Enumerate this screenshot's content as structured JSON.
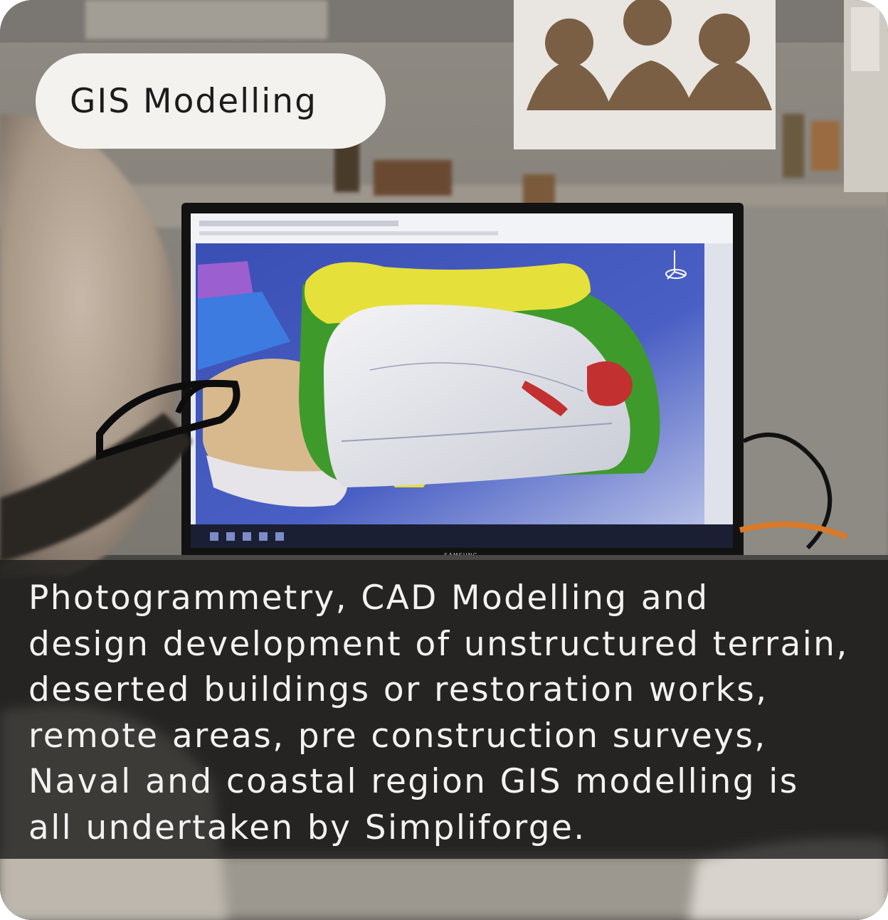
{
  "card": {
    "badge_label": "GIS Modelling",
    "caption_lines": [
      "Photogrammetry, CAD Modelling and",
      "design development of unstructured terrain,",
      "deserted buildings or restoration works,",
      "remote areas, pre construction surveys,",
      "Naval and coastal region GIS modelling is",
      "all undertaken by Simpliforge."
    ],
    "monitor_brand": "SAMSUNG"
  },
  "colors": {
    "badge_bg": "#f4f2ef",
    "caption_bg": "#1c1b1a",
    "caption_text": "#f2f2f2",
    "cad_background": "#2b3f9e",
    "cad_green": "#3f9a2c",
    "cad_yellow": "#e6e03a",
    "cad_red": "#c23030"
  }
}
